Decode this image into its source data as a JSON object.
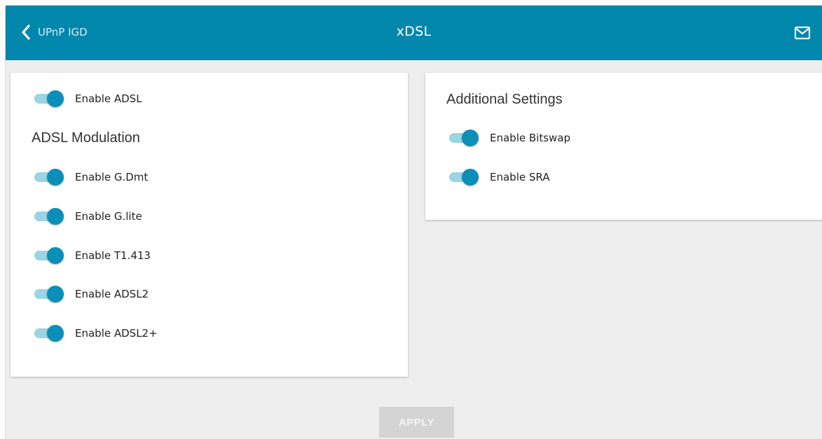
{
  "header": {
    "back_label": "UPnP IGD",
    "title": "xDSL",
    "back_icon": "chevron-left-icon",
    "mail_icon": "mail-icon",
    "color": "#0186ac"
  },
  "left_card": {
    "enable_adsl": {
      "label": "Enable ADSL",
      "checked": true
    },
    "modulation_title": "ADSL Modulation",
    "modulations": [
      {
        "label": "Enable G.Dmt",
        "checked": true
      },
      {
        "label": "Enable G.lite",
        "checked": true
      },
      {
        "label": "Enable T1.413",
        "checked": true
      },
      {
        "label": "Enable ADSL2",
        "checked": true
      },
      {
        "label": "Enable ADSL2+",
        "checked": true
      }
    ]
  },
  "right_card": {
    "title": "Additional Settings",
    "options": [
      {
        "label": "Enable Bitswap",
        "checked": true
      },
      {
        "label": "Enable SRA",
        "checked": true
      }
    ]
  },
  "apply": {
    "label": "APPLY",
    "disabled": true
  },
  "colors": {
    "toggle_on_knob": "#0a8fb8",
    "toggle_on_track": "#9bd4e4",
    "background": "#eeeeee"
  }
}
